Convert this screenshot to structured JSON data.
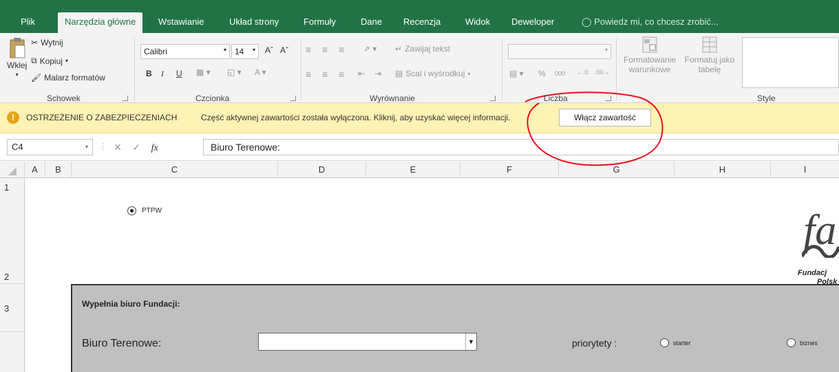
{
  "tabs": [
    "Plik",
    "Narzędzia główne",
    "Wstawianie",
    "Układ strony",
    "Formuły",
    "Dane",
    "Recenzja",
    "Widok",
    "Deweloper"
  ],
  "tell_me": "Powiedz mi, co chcesz zrobić...",
  "ribbon": {
    "clipboard": {
      "paste": "Wklej",
      "cut": "Wytnij",
      "copy": "Kopiuj",
      "format_painter": "Malarz formatów",
      "label": "Schowek"
    },
    "font": {
      "name": "Calibri",
      "size": "14",
      "bold": "B",
      "italic": "I",
      "underline": "U",
      "label": "Czcionka"
    },
    "alignment": {
      "wrap": "Zawijaj tekst",
      "merge": "Scal i wyśrodkuj",
      "label": "Wyrównanie"
    },
    "number": {
      "percent": "%",
      "thousands": "000",
      "label": "Liczba"
    },
    "styles": {
      "conditional": "Formatowanie warunkowe",
      "format_table": "Formatuj jako tabelę",
      "label": "Style"
    }
  },
  "security_bar": {
    "title": "OSTRZEŻENIE O ZABEZPIECZENIACH",
    "message": "Część aktywnej zawartości została wyłączona. Kliknij, aby uzyskać więcej informacji.",
    "button": "Włącz zawartość"
  },
  "formula_bar": {
    "cell": "C4",
    "fx": "fx",
    "value": "Biuro Terenowe:"
  },
  "columns": [
    "A",
    "B",
    "C",
    "D",
    "E",
    "F",
    "G",
    "H",
    "I"
  ],
  "rows": [
    "1",
    "2",
    "3"
  ],
  "sheet": {
    "radio_ptpw": "PTPW",
    "grey_header": "Wypełnia biuro Fundacji:",
    "office_label": "Biuro Terenowe:",
    "priorities_label": "priorytety :",
    "radio_starter": "starter",
    "radio_biznes": "biznes",
    "logo_line1": "Fundacj",
    "logo_line2": "Polsk"
  },
  "colors": {
    "accent": "#217346",
    "security_bg": "#fdf3b5",
    "annotation": "#e8101a"
  }
}
